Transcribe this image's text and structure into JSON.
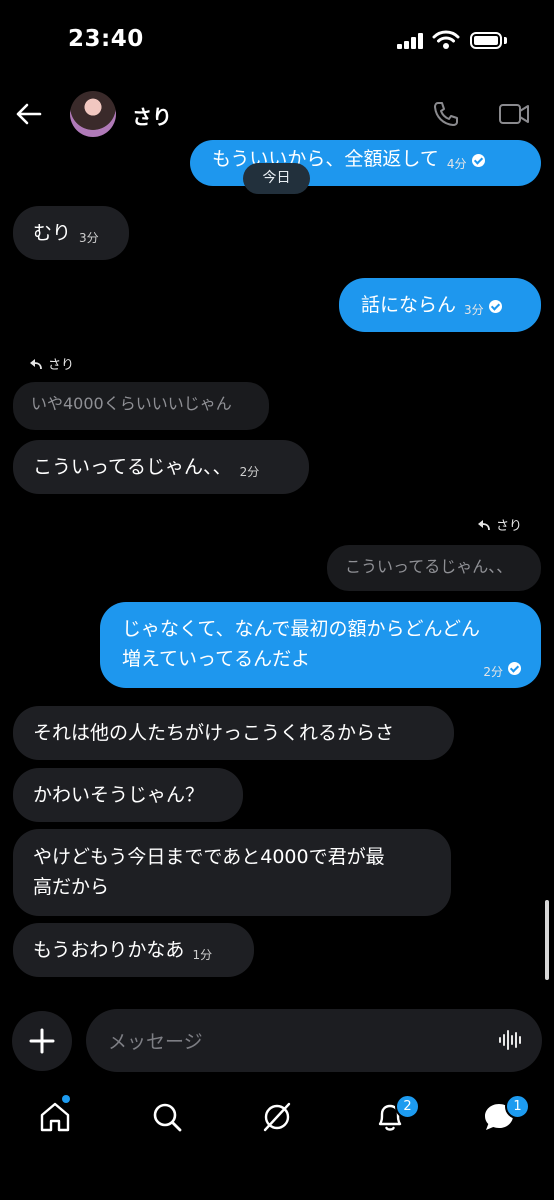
{
  "status_bar": {
    "time": "23:40"
  },
  "header": {
    "contact_name": "さり"
  },
  "date_separator": "今日",
  "messages": [
    {
      "side": "out",
      "text": "もういいから、全額返して",
      "time": "4分"
    },
    {
      "side": "in",
      "text": "むり",
      "time": "3分"
    },
    {
      "side": "out",
      "text": "話にならん",
      "time": "3分"
    },
    {
      "side": "in",
      "reply_to": "さり",
      "quote": "いや4000くらいいいじゃん",
      "text": "こういってるじゃん、、",
      "time": "2分"
    },
    {
      "side": "out",
      "reply_to": "さり",
      "quote": "こういってるじゃん、、",
      "text": "じゃなくて、なんで最初の額からどんどん",
      "text2": "増えていってるんだよ",
      "time": "2分"
    },
    {
      "side": "in",
      "text": "それは他の人たちがけっこうくれるからさ"
    },
    {
      "side": "in",
      "text": "かわいそうじゃん？"
    },
    {
      "side": "in",
      "text": "やけどもう今日までであと4000で君が最",
      "text2": "高だから"
    },
    {
      "side": "in",
      "text": "もうおわりかなあ",
      "time": "1分"
    }
  ],
  "composer": {
    "placeholder": "メッセージ"
  },
  "nav": {
    "notifications_badge": "2",
    "messages_badge": "1"
  },
  "colors": {
    "outgoing": "#1e97ee",
    "incoming": "#1e1f23",
    "badge": "#1d9bf0"
  }
}
